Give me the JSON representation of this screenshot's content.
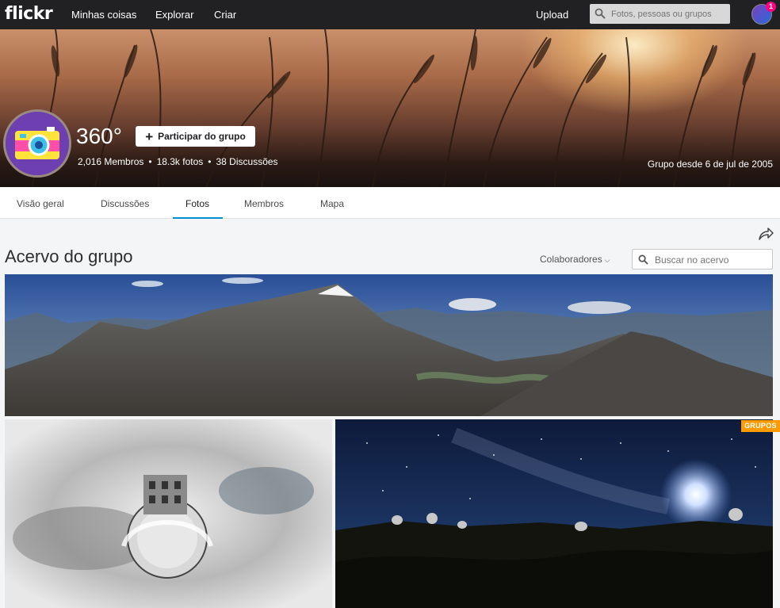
{
  "topnav": {
    "logo": "flickr",
    "links": [
      "Minhas coisas",
      "Explorar",
      "Criar"
    ],
    "upload": "Upload",
    "search_placeholder": "Fotos, pessoas ou grupos",
    "notifications": "1"
  },
  "group": {
    "title": "360°",
    "join_label": "Participar do grupo",
    "members": "2,016 Membros",
    "photos": "18.3k fotos",
    "discussions": "38 Discussões",
    "since": "Grupo desde 6 de jul de 2005"
  },
  "tabs": [
    "Visão geral",
    "Discussões",
    "Fotos",
    "Membros",
    "Mapa"
  ],
  "active_tab": "Fotos",
  "pool": {
    "title": "Acervo do grupo",
    "filter": "Colaboradores",
    "search_placeholder": "Buscar no acervo"
  },
  "badge": "GRUPOS",
  "colors": {
    "nav_bg": "#212124",
    "accent": "#008ecf",
    "badge": "#ff9a00",
    "notification": "#ff0084"
  }
}
